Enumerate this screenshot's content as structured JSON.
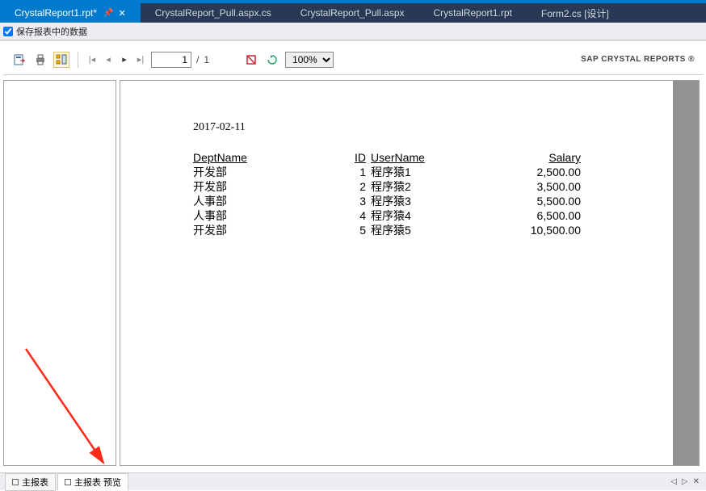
{
  "tabs": [
    {
      "label": "CrystalReport1.rpt*",
      "active": true,
      "pinned": true,
      "closeable": true
    },
    {
      "label": "CrystalReport_Pull.aspx.cs",
      "active": false
    },
    {
      "label": "CrystalReport_Pull.aspx",
      "active": false
    },
    {
      "label": "CrystalReport1.rpt",
      "active": false
    },
    {
      "label": "Form2.cs [设计]",
      "active": false
    }
  ],
  "subbar": {
    "checkbox_label": "保存报表中的数据"
  },
  "toolbar": {
    "page_current": "1",
    "page_sep": "/",
    "page_total": "1",
    "zoom": "100%",
    "brand": "SAP CRYSTAL REPORTS ®"
  },
  "report": {
    "date": "2017-02-11",
    "headers": {
      "dept": "DeptName",
      "id": "ID",
      "user": "UserName",
      "salary": "Salary"
    },
    "rows": [
      {
        "dept": "开发部",
        "id": "1",
        "user": "程序猿1",
        "salary": "2,500.00"
      },
      {
        "dept": "开发部",
        "id": "2",
        "user": "程序猿2",
        "salary": "3,500.00"
      },
      {
        "dept": "人事部",
        "id": "3",
        "user": "程序猿3",
        "salary": "5,500.00"
      },
      {
        "dept": "人事部",
        "id": "4",
        "user": "程序猿4",
        "salary": "6,500.00"
      },
      {
        "dept": "开发部",
        "id": "5",
        "user": "程序猿5",
        "salary": "10,500.00"
      }
    ]
  },
  "footer_tabs": [
    {
      "label": "主报表",
      "active": false
    },
    {
      "label": "主报表 预览",
      "active": true
    }
  ]
}
